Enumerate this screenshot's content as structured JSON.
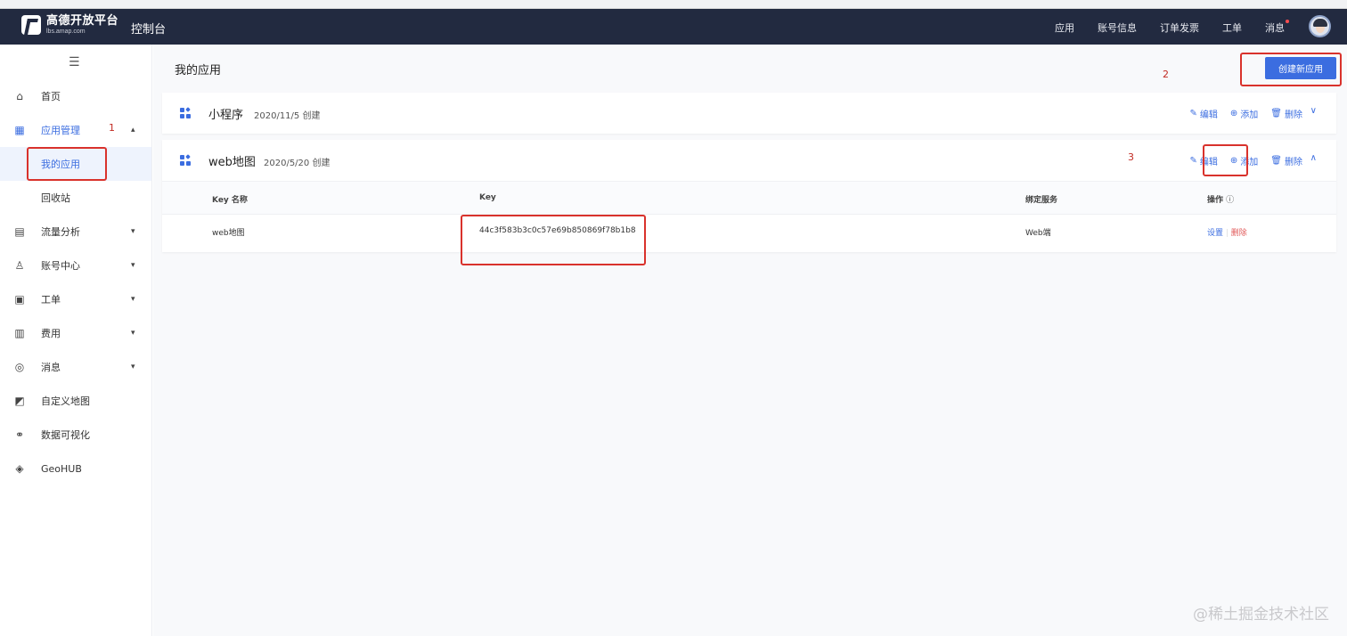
{
  "topbar": {
    "logo_title": "高德开放平台",
    "logo_sub": "lbs.amap.com",
    "console": "控制台",
    "nav": [
      "应用",
      "账号信息",
      "订单发票",
      "工单",
      "消息"
    ]
  },
  "sidebar": {
    "items": [
      {
        "label": "首页",
        "icon": "home-icon"
      },
      {
        "label": "应用管理",
        "icon": "grid-icon"
      },
      {
        "label": "我的应用"
      },
      {
        "label": "回收站"
      },
      {
        "label": "流量分析",
        "icon": "chart-icon"
      },
      {
        "label": "账号中心",
        "icon": "user-icon"
      },
      {
        "label": "工单",
        "icon": "ticket-icon"
      },
      {
        "label": "费用",
        "icon": "bill-icon"
      },
      {
        "label": "消息",
        "icon": "message-icon"
      },
      {
        "label": "自定义地图",
        "icon": "map-icon"
      },
      {
        "label": "数据可视化",
        "icon": "visual-icon"
      },
      {
        "label": "GeoHUB",
        "icon": "layers-icon"
      }
    ]
  },
  "main": {
    "title": "我的应用",
    "create_button": "创建新应用",
    "apps": [
      {
        "name": "小程序",
        "date": "2020/11/5 创建"
      },
      {
        "name": "web地图",
        "date": "2020/5/20 创建"
      }
    ],
    "actions": {
      "edit": "编辑",
      "add": "添加",
      "delete": "删除"
    },
    "table": {
      "headers": [
        "Key 名称",
        "Key",
        "绑定服务",
        "操作"
      ],
      "rows": [
        {
          "name": "web地图",
          "key": "44c3f583b3c0c57e69b850869f78b1b8",
          "service": "Web端",
          "op_set": "设置",
          "op_del": "删除"
        }
      ]
    }
  },
  "annotations": [
    "1",
    "2",
    "3"
  ],
  "watermark": "@稀土掘金技术社区",
  "colors": {
    "accent": "#3b6de0",
    "topbar": "#222a40",
    "annotation": "#d9322c"
  }
}
